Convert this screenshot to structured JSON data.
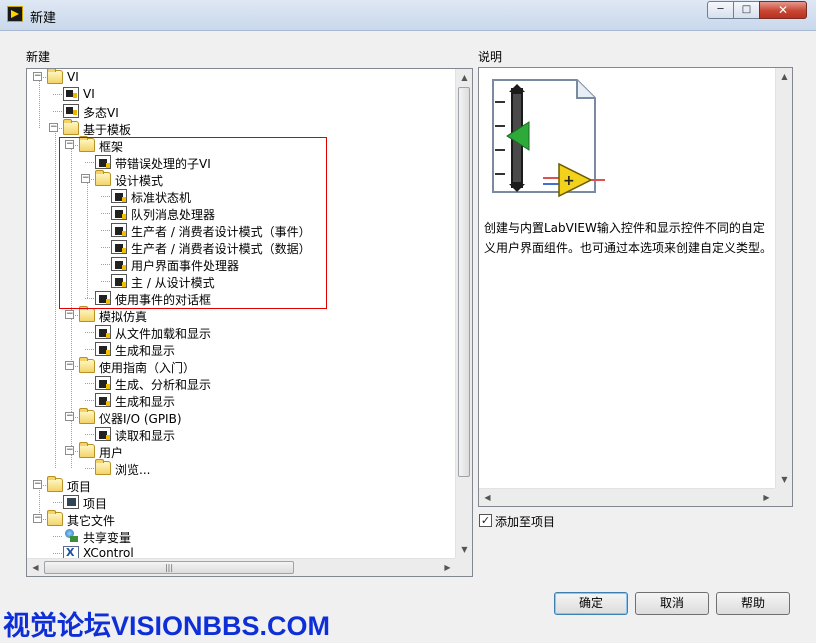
{
  "window": {
    "title": "新建",
    "close_glyph": "✕",
    "min_glyph": "─",
    "max_glyph": "□"
  },
  "left": {
    "section_label": "新建"
  },
  "tree": [
    {
      "text": "VI",
      "icon": "folder-icon",
      "expander": "⊟"
    },
    {
      "text": "VI",
      "icon": "vi-icon"
    },
    {
      "text": "多态VI",
      "icon": "vi-icon"
    },
    {
      "text": "基于模板",
      "icon": "folder-icon",
      "expander": "⊟"
    },
    {
      "text": "框架",
      "icon": "folder-icon",
      "expander": "⊟"
    },
    {
      "text": "带错误处理的子VI",
      "icon": "template-icon"
    },
    {
      "text": "设计模式",
      "icon": "folder-icon",
      "expander": "⊟"
    },
    {
      "text": "标准状态机",
      "icon": "template-icon"
    },
    {
      "text": "队列消息处理器",
      "icon": "template-icon"
    },
    {
      "text": "生产者 / 消费者设计模式（事件）",
      "icon": "template-icon"
    },
    {
      "text": "生产者 / 消费者设计模式（数据）",
      "icon": "template-icon"
    },
    {
      "text": "用户界面事件处理器",
      "icon": "template-icon"
    },
    {
      "text": "主 / 从设计模式",
      "icon": "template-icon"
    },
    {
      "text": "使用事件的对话框",
      "icon": "template-icon"
    },
    {
      "text": "模拟仿真",
      "icon": "folder-icon",
      "expander": "⊟"
    },
    {
      "text": "从文件加载和显示",
      "icon": "template-icon"
    },
    {
      "text": "生成和显示",
      "icon": "template-icon"
    },
    {
      "text": "使用指南（入门）",
      "icon": "folder-icon",
      "expander": "⊟"
    },
    {
      "text": "生成、分析和显示",
      "icon": "template-icon"
    },
    {
      "text": "生成和显示",
      "icon": "template-icon"
    },
    {
      "text": "仪器I/O (GPIB)",
      "icon": "folder-icon",
      "expander": "⊟"
    },
    {
      "text": "读取和显示",
      "icon": "template-icon"
    },
    {
      "text": "用户",
      "icon": "folder-icon",
      "expander": "⊟"
    },
    {
      "text": "浏览...",
      "icon": "folder-icon"
    },
    {
      "text": "项目",
      "icon": "folder-icon",
      "expander": "⊟"
    },
    {
      "text": "项目",
      "icon": "project-icon"
    },
    {
      "text": "其它文件",
      "icon": "folder-icon",
      "expander": "⊟"
    },
    {
      "text": "共享变量",
      "icon": "shared-variable-icon"
    },
    {
      "text": "XControl",
      "icon": "xcontrol-icon"
    }
  ],
  "right": {
    "section_label": "说明",
    "description": "创建与内置LabVIEW输入控件和显示控件不同的自定义用户界面组件。也可通过本选项来创建自定义类型。",
    "add_to_project_label": "添加至项目",
    "add_to_project_checked": true,
    "check_glyph": "✓"
  },
  "buttons": {
    "ok": "确定",
    "cancel": "取消",
    "help": "帮助"
  },
  "scroll_arrows": {
    "up": "▲",
    "down": "▼",
    "left": "◀",
    "right": "▶",
    "grip": "|||"
  },
  "watermark": "视觉论坛VISIONBBS.COM"
}
